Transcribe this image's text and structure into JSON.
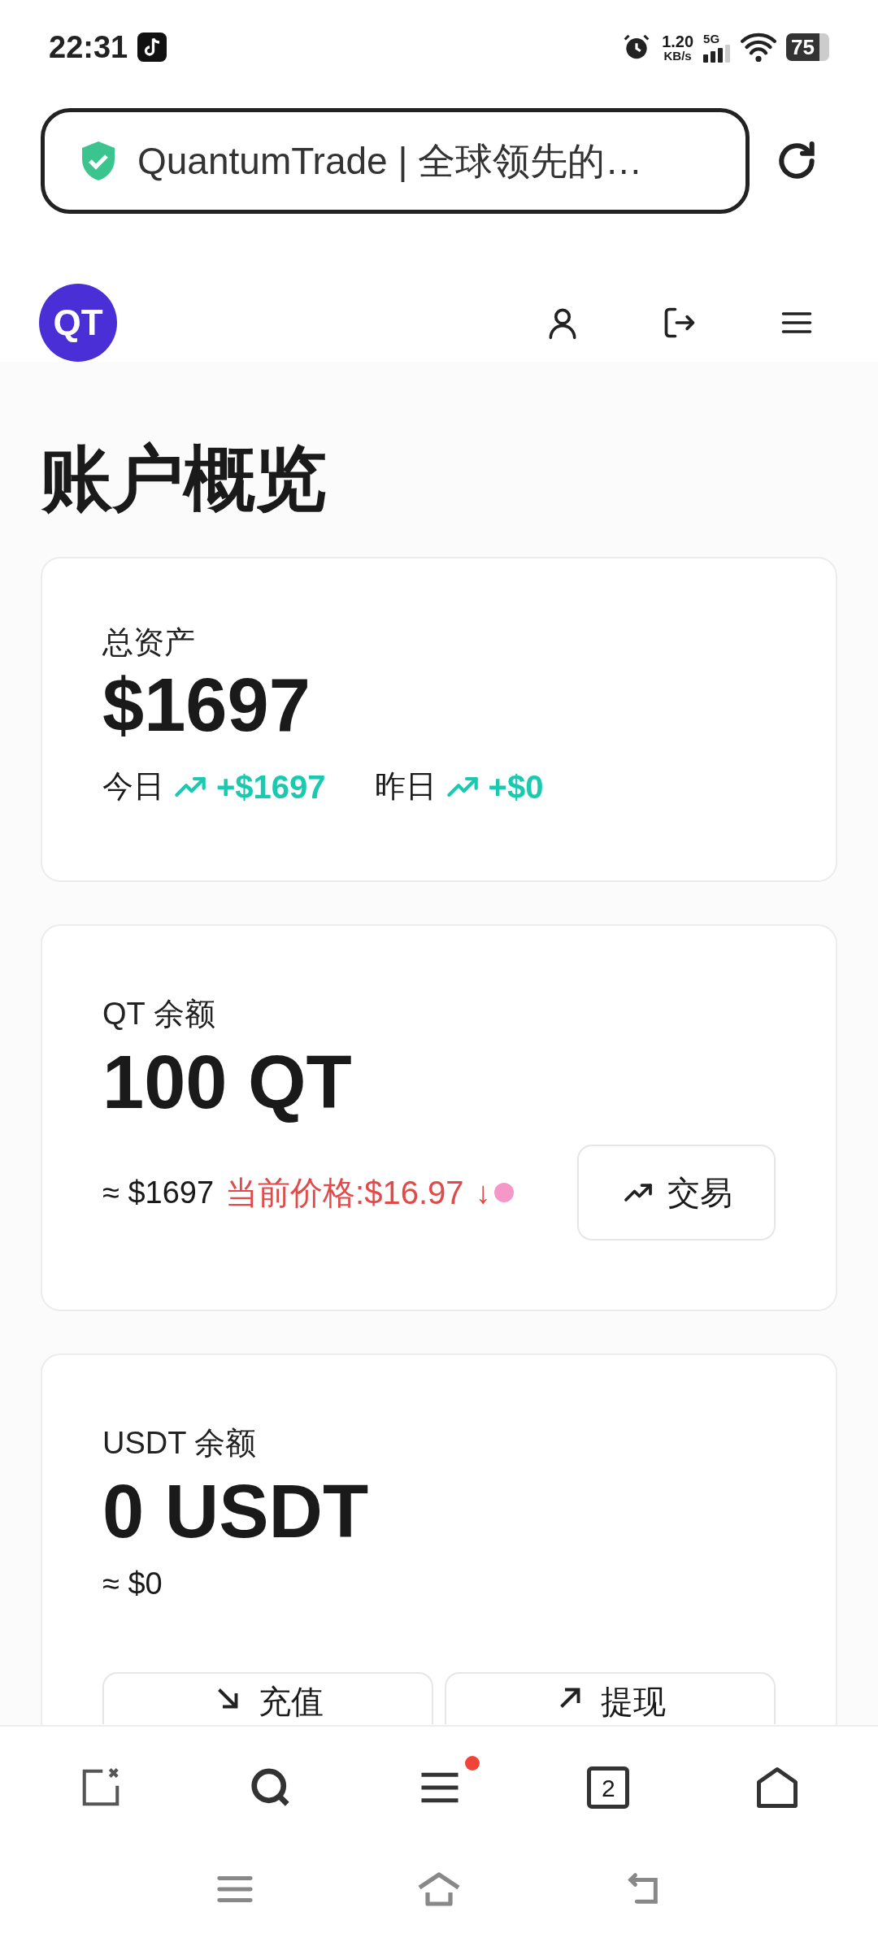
{
  "status_bar": {
    "time": "22:31",
    "net_speed": "1.20",
    "net_unit": "KB/s",
    "network": "5G",
    "battery": "75"
  },
  "browser": {
    "title": "QuantumTrade | 全球领先的…"
  },
  "header": {
    "avatar": "QT"
  },
  "page_title": "账户概览",
  "total_assets": {
    "label": "总资产",
    "amount": "$1697",
    "changes": [
      {
        "label": "今日",
        "value": "+$1697"
      },
      {
        "label": "昨日",
        "value": "+$0"
      }
    ]
  },
  "qt_balance": {
    "label": "QT 余额",
    "amount": "100 QT",
    "approx": "≈ $1697",
    "price": "当前价格:$16.97",
    "price_arrow": "↓",
    "action": "交易"
  },
  "usdt_balance": {
    "label": "USDT 余额",
    "amount": "0 USDT",
    "approx": "≈ $0",
    "actions": [
      {
        "kind": "deposit",
        "label": "充值"
      },
      {
        "kind": "withdraw",
        "label": "提现"
      }
    ]
  },
  "browser_toolbar": {
    "tab_count": "2",
    "menu_badge": true
  }
}
